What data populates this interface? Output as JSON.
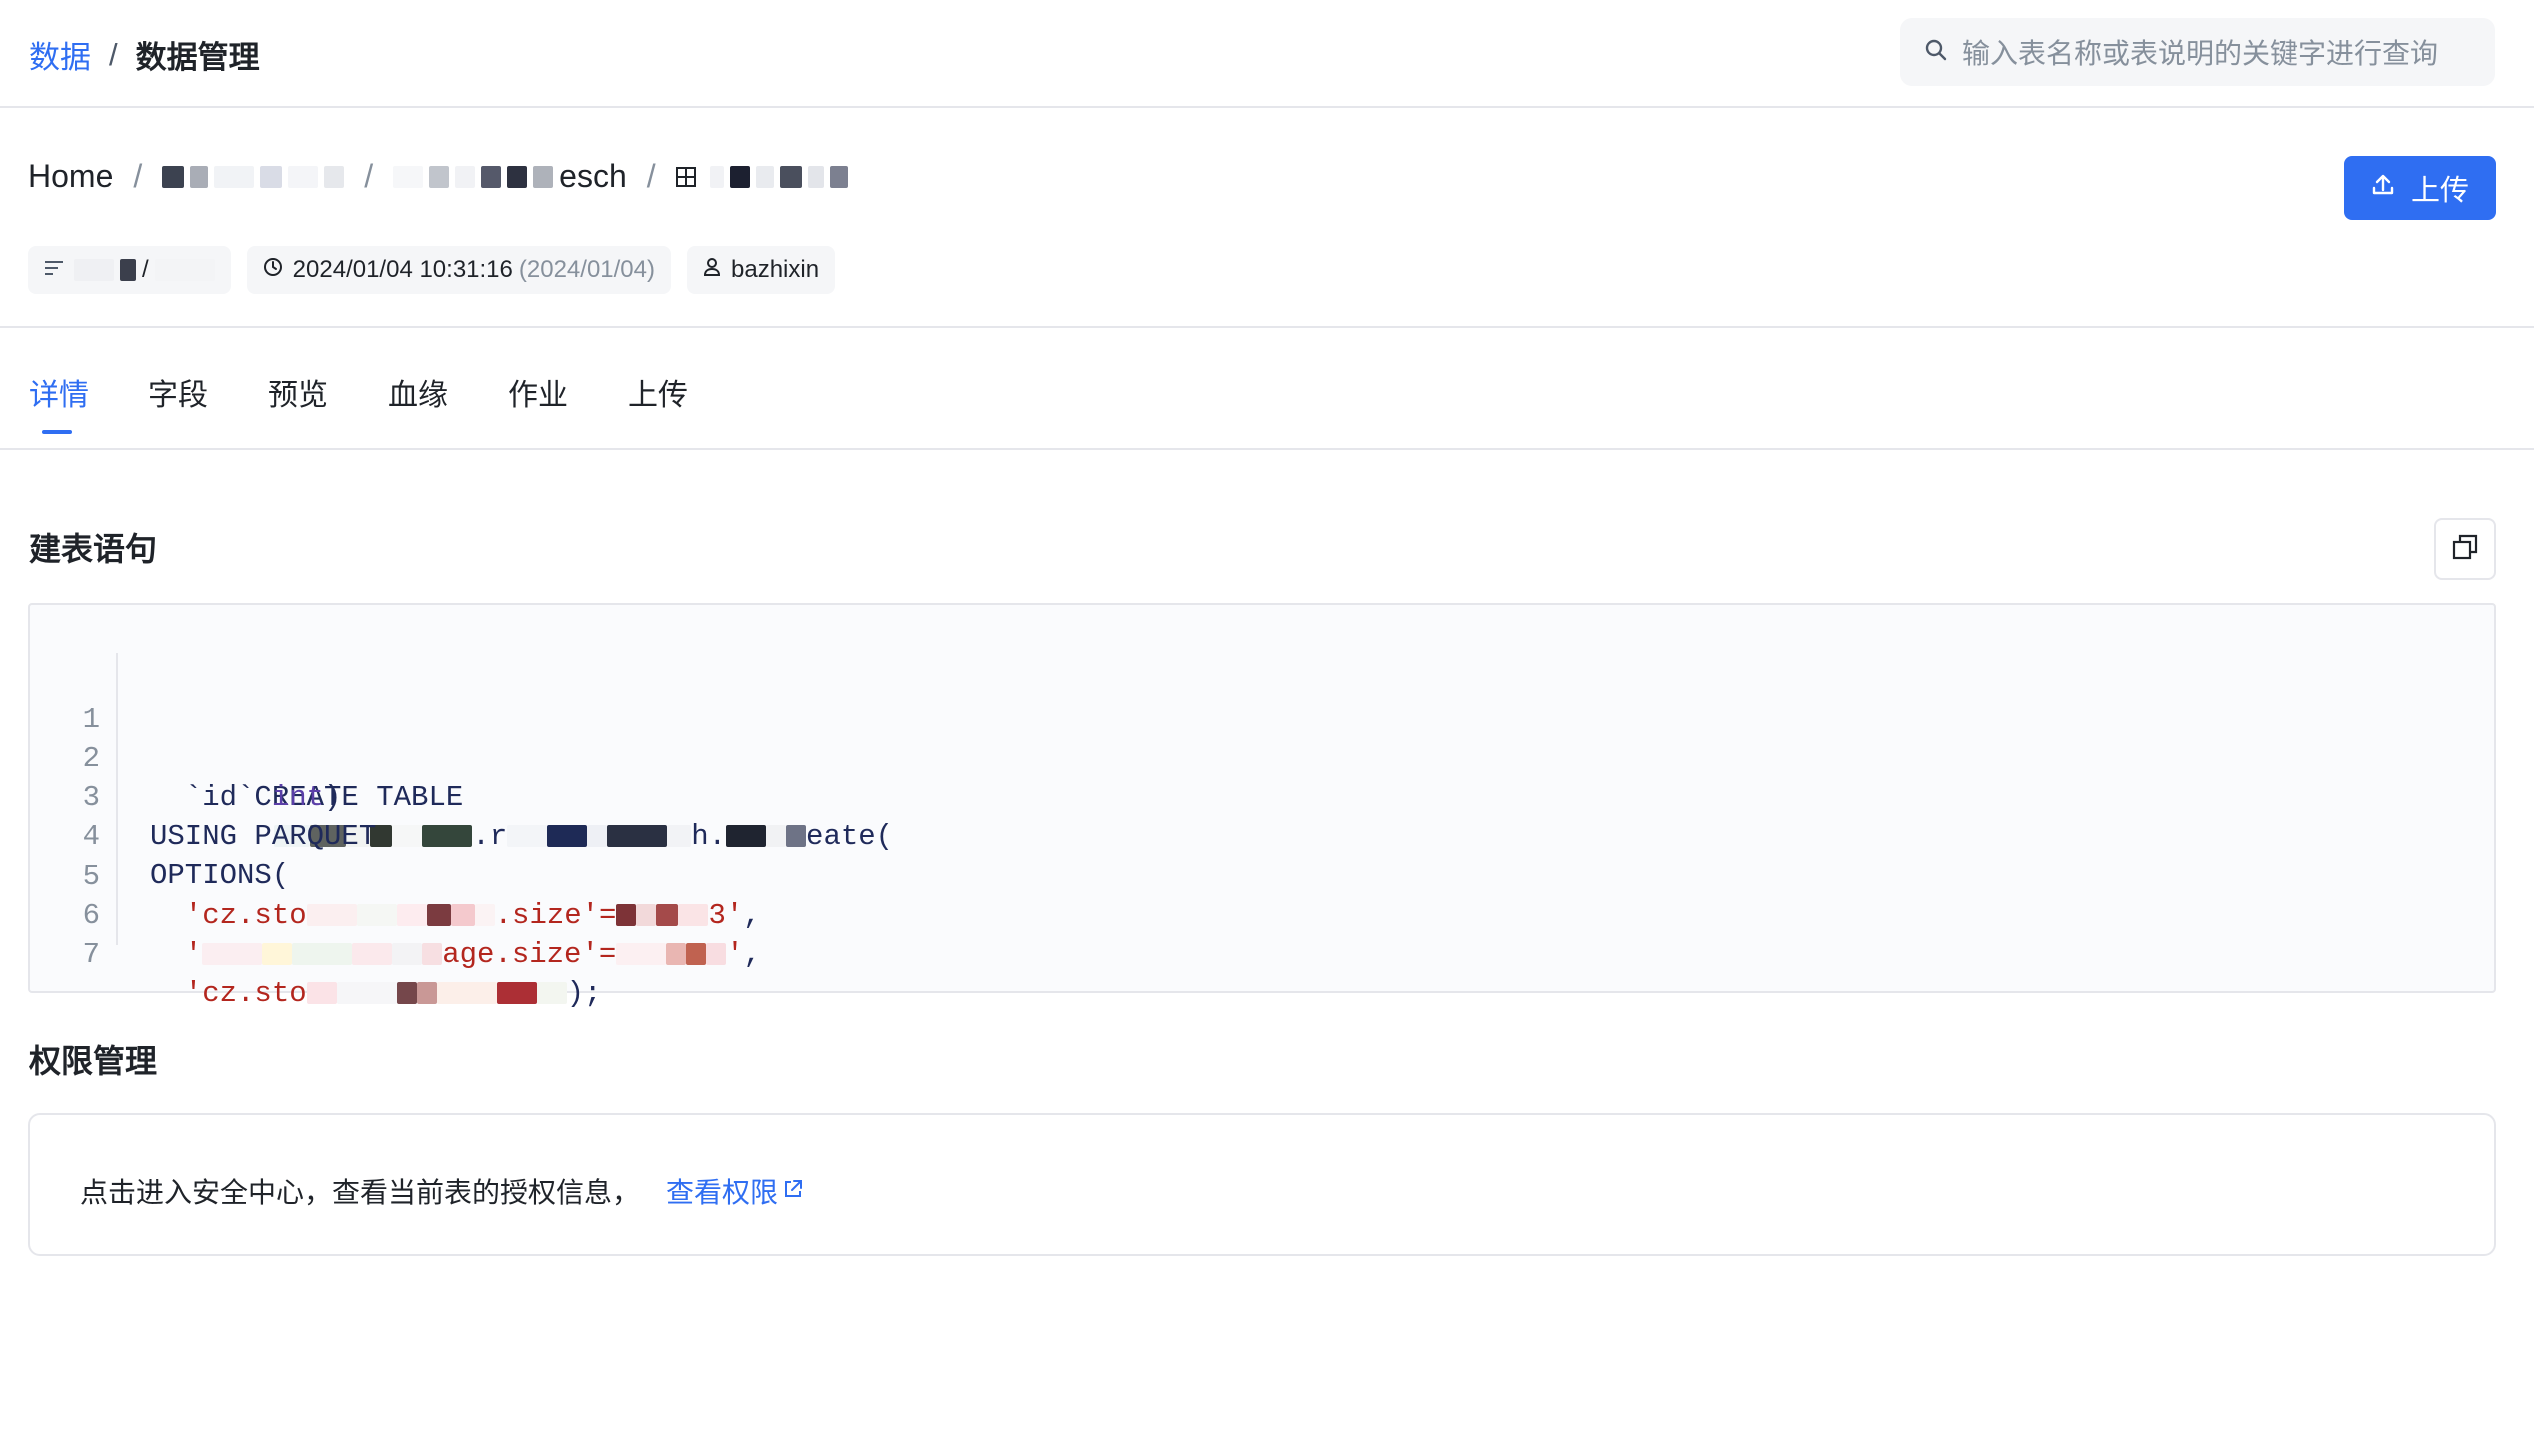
{
  "topbar": {
    "breadcrumb_root": "数据",
    "separator": "/",
    "breadcrumb_current": "数据管理",
    "search_placeholder": "输入表名称或表说明的关键字进行查询"
  },
  "header": {
    "path_home": "Home",
    "path_separator": "/",
    "path_partial_text": "esch",
    "upload_label": "上传",
    "meta": {
      "datetime": "2024/01/04 10:31:16",
      "date_paren": "(2024/01/04)",
      "owner": "bazhixin"
    }
  },
  "tabs": [
    {
      "label": "详情",
      "active": true
    },
    {
      "label": "字段",
      "active": false
    },
    {
      "label": "预览",
      "active": false
    },
    {
      "label": "血缘",
      "active": false
    },
    {
      "label": "作业",
      "active": false
    },
    {
      "label": "上传",
      "active": false
    }
  ],
  "ddl_section": {
    "title": "建表语句",
    "lines": [
      {
        "n": "1",
        "text": "CREATE TABLE",
        "tail": ".r",
        "tail2": "h.",
        "end": "eate("
      },
      {
        "n": "2",
        "text": "  `id` ",
        "type": "int",
        "end": ")"
      },
      {
        "n": "3",
        "text": "USING PARQUET"
      },
      {
        "n": "4",
        "text": "OPTIONS("
      },
      {
        "n": "5",
        "str1": "  'cz.sto",
        "str2": ".size'=",
        "str3": "3'",
        "end": ","
      },
      {
        "n": "6",
        "str1": "  '",
        "str2": "age.size'=",
        "str3": "'",
        "end": ","
      },
      {
        "n": "7",
        "str1": "  'cz.sto",
        "end": ");"
      }
    ]
  },
  "permission_section": {
    "title": "权限管理",
    "text": "点击进入安全中心，查看当前表的授权信息，",
    "link_label": "查看权限"
  }
}
